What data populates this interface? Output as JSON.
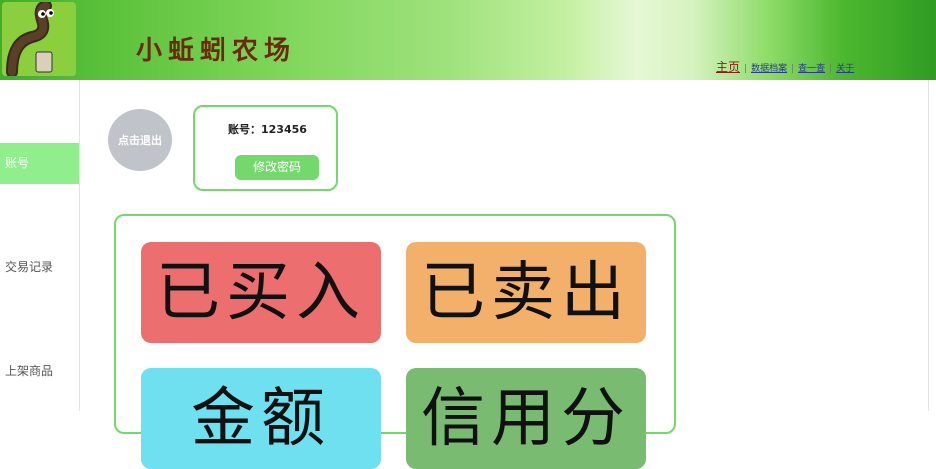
{
  "header": {
    "site_title": "小蚯蚓农场",
    "nav": {
      "home": "主页",
      "data_archive": "数据档案",
      "lookup": "查一查",
      "about": "关于"
    }
  },
  "sidebar": {
    "items": [
      {
        "label": "账号",
        "active": true
      },
      {
        "label": "交易记录",
        "active": false
      },
      {
        "label": "上架商品",
        "active": false
      }
    ]
  },
  "account": {
    "logout_label": "点击退出",
    "account_label": "账号：",
    "account_value": "123456",
    "change_password_label": "修改密码"
  },
  "tiles": [
    {
      "label": "已买入",
      "color": "#ec6e6f"
    },
    {
      "label": "已卖出",
      "color": "#f2b06a"
    },
    {
      "label": "金额",
      "color": "#6fe0f0"
    },
    {
      "label": "信用分",
      "color": "#7abb72"
    }
  ],
  "colors": {
    "accent_green": "#73d96a",
    "active_sidebar": "#90ee8c",
    "logout_circle": "#c0c3c9"
  }
}
